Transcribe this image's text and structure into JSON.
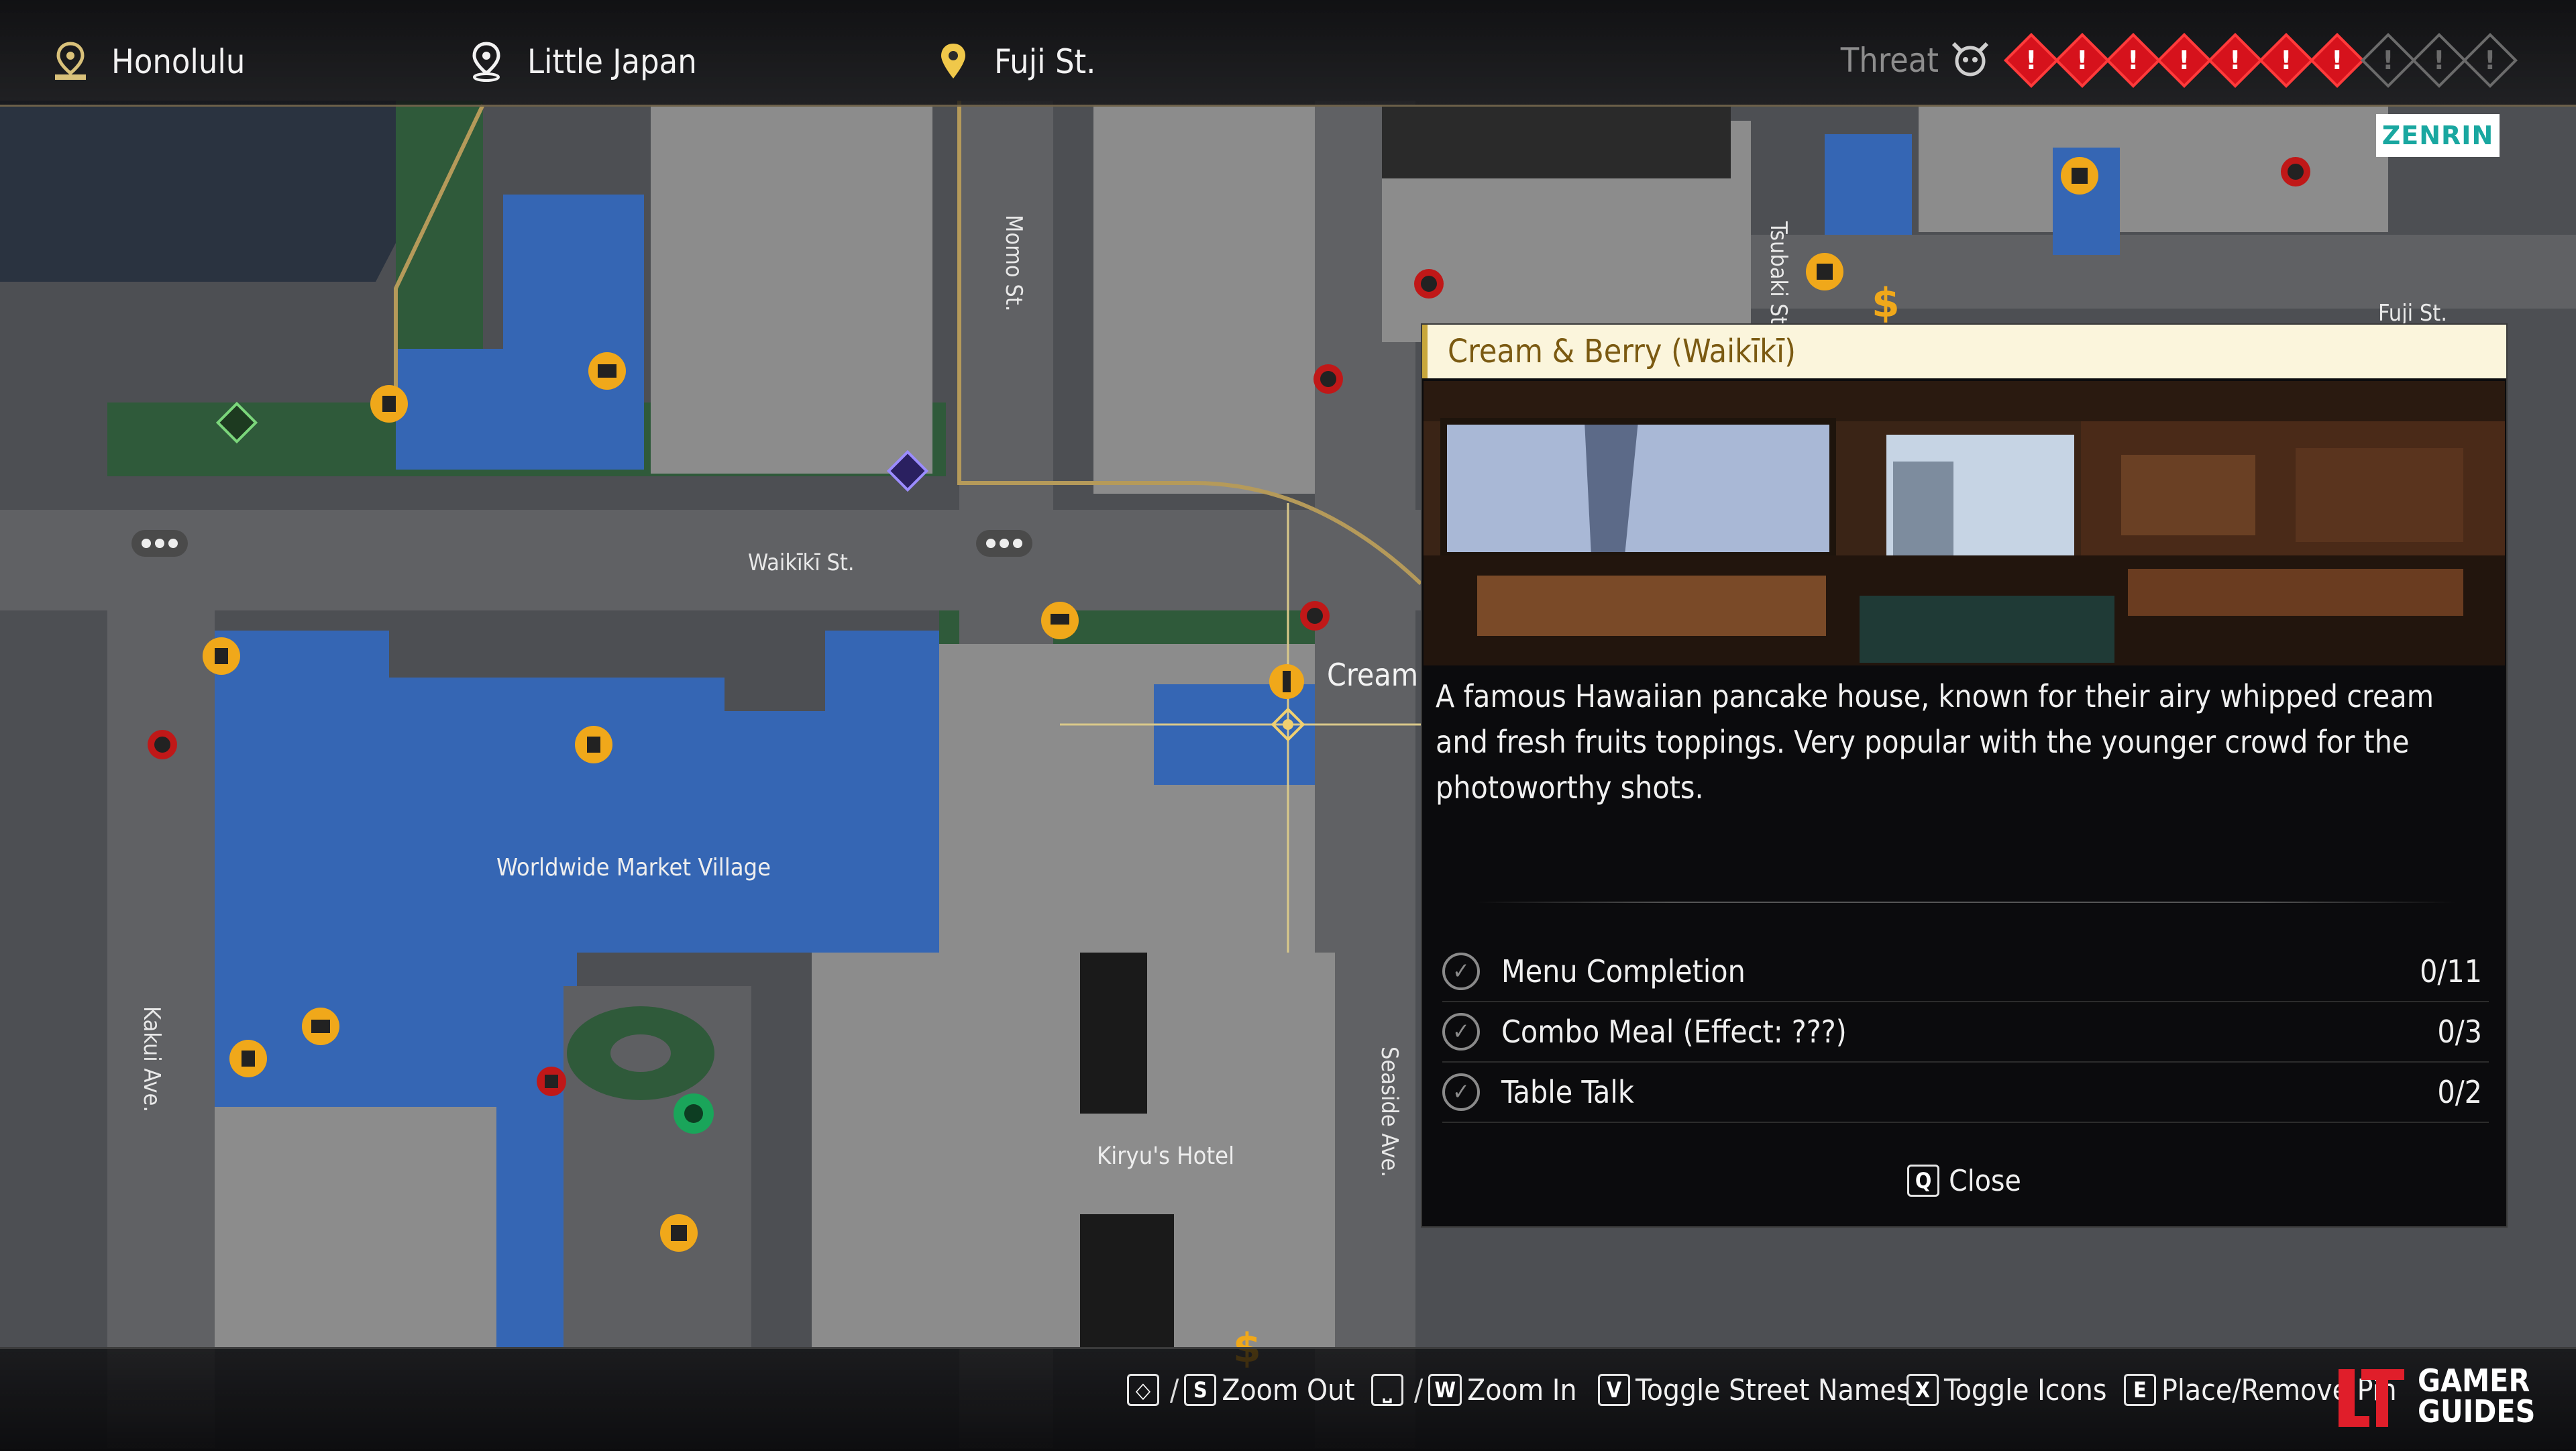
{
  "breadcrumb": {
    "region": "Honolulu",
    "district": "Little Japan",
    "street": "Fuji St."
  },
  "threat": {
    "label": "Threat",
    "level": 7,
    "max": 10
  },
  "map": {
    "provider": "ZENRIN",
    "streets": {
      "waikiki": "Waikīkī St.",
      "momo": "Momo St.",
      "tsubaki": "Tsubaki St.",
      "fuji": "Fuji St.",
      "seaside": "Seaside Ave.",
      "kakui": "Kakui Ave."
    },
    "places": {
      "market": "Worldwide Market Village",
      "hotel": "Kiryu's Hotel"
    },
    "cursor_label": "Cream"
  },
  "panel": {
    "title": "Cream & Berry (Waikīkī)",
    "description": "A famous Hawaiian pancake house, known for their airy whipped cream and fresh fruits toppings. Very popular with the younger crowd for the photoworthy shots.",
    "tasks": [
      {
        "name": "Menu Completion",
        "value": "0/11"
      },
      {
        "name": "Combo Meal (Effect: ???)",
        "value": "0/3"
      },
      {
        "name": "Table Talk",
        "value": "0/2"
      }
    ],
    "close_key": "Q",
    "close_label": "Close"
  },
  "controls": {
    "zoom_out_key": "S",
    "zoom_out": "Zoom Out",
    "zoom_in_key": "W",
    "zoom_in": "Zoom In",
    "toggle_streets_key": "V",
    "toggle_streets": "Toggle Street Names",
    "toggle_icons_key": "X",
    "toggle_icons": "Toggle Icons",
    "place_key": "E",
    "place": "Place/Remove Pin",
    "slash": "/"
  },
  "watermark": {
    "line1": "GAMER",
    "line2": "GUIDES"
  },
  "colors": {
    "water": "#3566b4",
    "building": "#8c8c8c",
    "road": "#5f6063",
    "park": "#2f5a3a",
    "threat_on": "#d6121c",
    "gold": "#c8a73c",
    "icon_yellow": "#f0a81a"
  }
}
